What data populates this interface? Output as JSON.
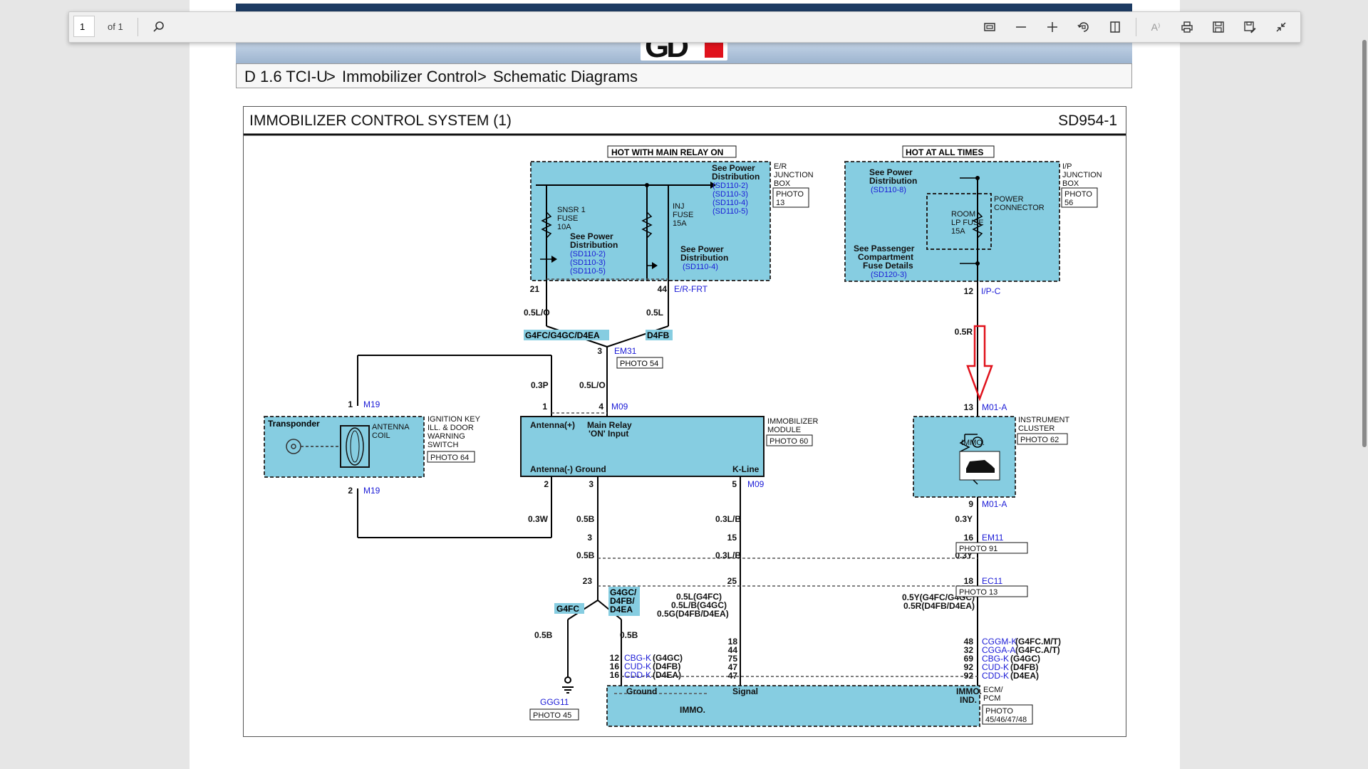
{
  "toolbar": {
    "page_value": "1",
    "page_count": "of 1",
    "icons": [
      "search-icon",
      "fit-page-icon",
      "zoom-out-icon",
      "zoom-in-icon",
      "rotate-icon",
      "page-view-icon",
      "read-aloud-icon",
      "print-icon",
      "save-icon",
      "save-as-icon",
      "exit-fullscreen-icon"
    ],
    "read_aloud_label": "A⁾"
  },
  "breadcrumb": [
    "D 1.6 TCI-U",
    ">",
    "Immobilizer Control",
    ">",
    "Schematic Diagrams"
  ],
  "diagram": {
    "title": "IMMOBILIZER CONTROL SYSTEM (1)",
    "code": "SD954-1",
    "colors": {
      "fill": "#86cde1",
      "wire": "#000000",
      "link": "#1a1ad6",
      "arrow": "#e0121c"
    },
    "labels": {
      "hot_main_relay": "HOT WITH MAIN RELAY ON",
      "hot_all_times": "HOT AT ALL TIMES",
      "er_box": [
        "E/R",
        "JUNCTION",
        "BOX"
      ],
      "er_photo": [
        "PHOTO",
        "13"
      ],
      "ip_box": [
        "I/P",
        "JUNCTION",
        "BOX"
      ],
      "ip_photo": [
        "PHOTO",
        "56"
      ],
      "see_power_1": [
        "See Power",
        "Distribution"
      ],
      "refs_1": [
        "(SD110-2)",
        "(SD110-3)",
        "(SD110-4)",
        "(SD110-5)"
      ],
      "snsr_fuse": [
        "SNSR 1",
        "FUSE",
        "10A"
      ],
      "inj_fuse": [
        "INJ",
        "FUSE",
        "15A"
      ],
      "see_power_2": [
        "See Power",
        "Distribution"
      ],
      "refs_2": [
        "(SD110-2)",
        "(SD110-3)",
        "(SD110-5)"
      ],
      "see_power_3": [
        "See Power",
        "Distribution"
      ],
      "refs_3": [
        "(SD110-4)"
      ],
      "see_power_4": [
        "See Power",
        "Distribution"
      ],
      "refs_4": [
        "(SD110-8)"
      ],
      "power_connector": [
        "POWER",
        "CONNECTOR"
      ],
      "room_fuse": [
        "ROOM",
        "LP FUSE",
        "15A"
      ],
      "see_passenger": [
        "See Passenger",
        "Compartment",
        "Fuse Details"
      ],
      "refs_5": [
        "(SD120-3)"
      ],
      "pin_21": "21",
      "pin_44": "44",
      "er_frt": "E/R-FRT",
      "pin_12": "12",
      "ip_c": "I/P-C",
      "w_05lo_1": "0.5L/O",
      "w_05l": "0.5L",
      "w_05r": "0.5R",
      "g4fc_group": "G4FC/G4GC/D4EA",
      "d4fb": "D4FB",
      "pin_3a": "3",
      "em31": "EM31",
      "photo_54": "PHOTO 54",
      "w_03p": "0.3P",
      "w_05lo_2": "0.5L/O",
      "pin_1a": "1",
      "m19_1": "M19",
      "pin_1b": "1",
      "pin_4": "4",
      "m09_1": "M09",
      "pin_13": "13",
      "m01a_1": "M01-A",
      "transponder": "Transponder",
      "antenna_coil": [
        "ANTENNA",
        "COIL"
      ],
      "ign_switch": [
        "IGNITION KEY",
        "ILL. & DOOR",
        "WARNING",
        "SWITCH"
      ],
      "photo_64": "PHOTO 64",
      "pin_2a": "2",
      "m19_2": "M19",
      "ant_plus": "Antenna(+)",
      "main_relay": [
        "Main Relay",
        "'ON' Input"
      ],
      "ant_minus": "Antenna(-) Ground",
      "k_line": "K-Line",
      "imm_module": [
        "IMMOBILIZER",
        "MODULE"
      ],
      "photo_60": "PHOTO 60",
      "inst_cluster": [
        "INSTRUMENT",
        "CLUSTER"
      ],
      "photo_62": "PHOTO 62",
      "immo_lamp": "IMMO.",
      "pin_2b": "2",
      "pin_3b": "3",
      "pin_5": "5",
      "m09_2": "M09",
      "pin_9": "9",
      "m01a_2": "M01-A",
      "w_03w": "0.3W",
      "w_05b_1": "0.5B",
      "w_03lb_1": "0.3L/B",
      "w_03y_1": "0.3Y",
      "pin_3c": "3",
      "pin_15": "15",
      "pin_16a": "16",
      "em11": "EM11",
      "photo_91": "PHOTO 91",
      "w_05b_2": "0.5B",
      "w_03lb_2": "0.3L/B",
      "w_03y_2": "0.3Y",
      "pin_23": "23",
      "pin_25": "25",
      "pin_18a": "18",
      "ec11": "EC11",
      "photo_13": "PHOTO 13",
      "g4gc_group": [
        "G4GC/",
        "D4FB/",
        "D4EA"
      ],
      "g4fc": "G4FC",
      "wires_mid": [
        "0.5L(G4FC)",
        "0.5L/B(G4GC)",
        "0.5G(D4FB/D4EA)"
      ],
      "wires_right": [
        "0.5Y(G4FC/G4GC)",
        "0.5R(D4FB/D4EA)"
      ],
      "w_05b_3": "0.5B",
      "w_05b_4": "0.5B",
      "pins_left": [
        "12",
        "16",
        "16"
      ],
      "ecm_left": [
        "CBG-K",
        "CUD-K",
        "CDD-K"
      ],
      "ecm_left_var": [
        "(G4GC)",
        "(D4FB)",
        "(D4EA)"
      ],
      "pins_mid": [
        "18",
        "44",
        "75",
        "47",
        "47"
      ],
      "pins_right": [
        "48",
        "32",
        "69",
        "92",
        "92"
      ],
      "ecm_right": [
        "CGGM-K",
        "CGGA-A",
        "CBG-K",
        "CUD-K",
        "CDD-K"
      ],
      "ecm_right_var": [
        "(G4FC.M/T)",
        "(G4FC.A/T)",
        "(G4GC)",
        "(D4FB)",
        "(D4EA)"
      ],
      "ground_label": "Ground",
      "signal_label": "Signal",
      "immo_ecm": "IMMO.",
      "immo_ind": [
        "IMMO.",
        "IND."
      ],
      "ecm_pcm": [
        "ECM/",
        "PCM"
      ],
      "ecm_photo": [
        "PHOTO",
        "45/46/47/48"
      ],
      "ggg11": "GGG11",
      "photo_45": "PHOTO 45"
    }
  }
}
